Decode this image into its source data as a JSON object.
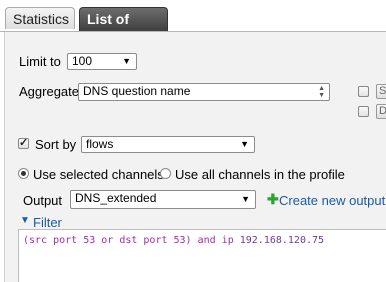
{
  "tabs": [
    {
      "label": "Statistics",
      "active": false
    },
    {
      "label": "List of flows",
      "active": true
    }
  ],
  "limit": {
    "label": "Limit to",
    "value": "100"
  },
  "aggregate": {
    "label": "Aggregate",
    "value": "DNS question name",
    "side_buttons": [
      "S",
      "D"
    ]
  },
  "sort": {
    "label": "Sort by",
    "checked": true,
    "value": "flows"
  },
  "channels": {
    "selected_label": "Use selected channels",
    "all_label": "Use all channels in the profile",
    "selected": "selected"
  },
  "output": {
    "label": "Output",
    "value": "DNS_extended",
    "create_label": "Create new output"
  },
  "filter": {
    "toggle_label": "Filter",
    "expression_part": "(src port 53 or dst port 53) and ip ",
    "expression_ip": "192.168.120.75"
  },
  "colors": {
    "link": "#1a5aa6",
    "filter_text": "#a12fa1",
    "plus": "#2fa12f"
  }
}
